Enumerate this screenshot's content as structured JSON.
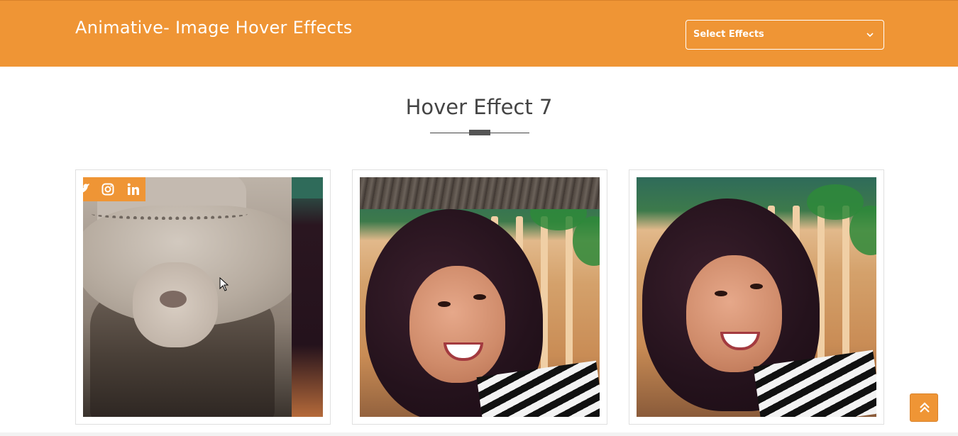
{
  "header": {
    "title": "Animative- Image Hover Effects",
    "select": {
      "selected": "Select Effects"
    }
  },
  "section": {
    "title": "Hover Effect 7"
  },
  "cards": [
    {
      "name": "card-1",
      "state": "hovered",
      "social_icons": [
        "twitter-icon",
        "instagram-icon",
        "linkedin-icon"
      ]
    },
    {
      "name": "card-2",
      "state": "transition"
    },
    {
      "name": "card-3",
      "state": "default"
    }
  ],
  "colors": {
    "accent": "#ef9535",
    "text_dark": "#444444",
    "border": "#e0e0e0"
  },
  "icons": [
    "chevron-down-icon",
    "twitter-icon",
    "instagram-icon",
    "linkedin-icon",
    "double-chevron-up-icon",
    "mouse-cursor-icon"
  ]
}
